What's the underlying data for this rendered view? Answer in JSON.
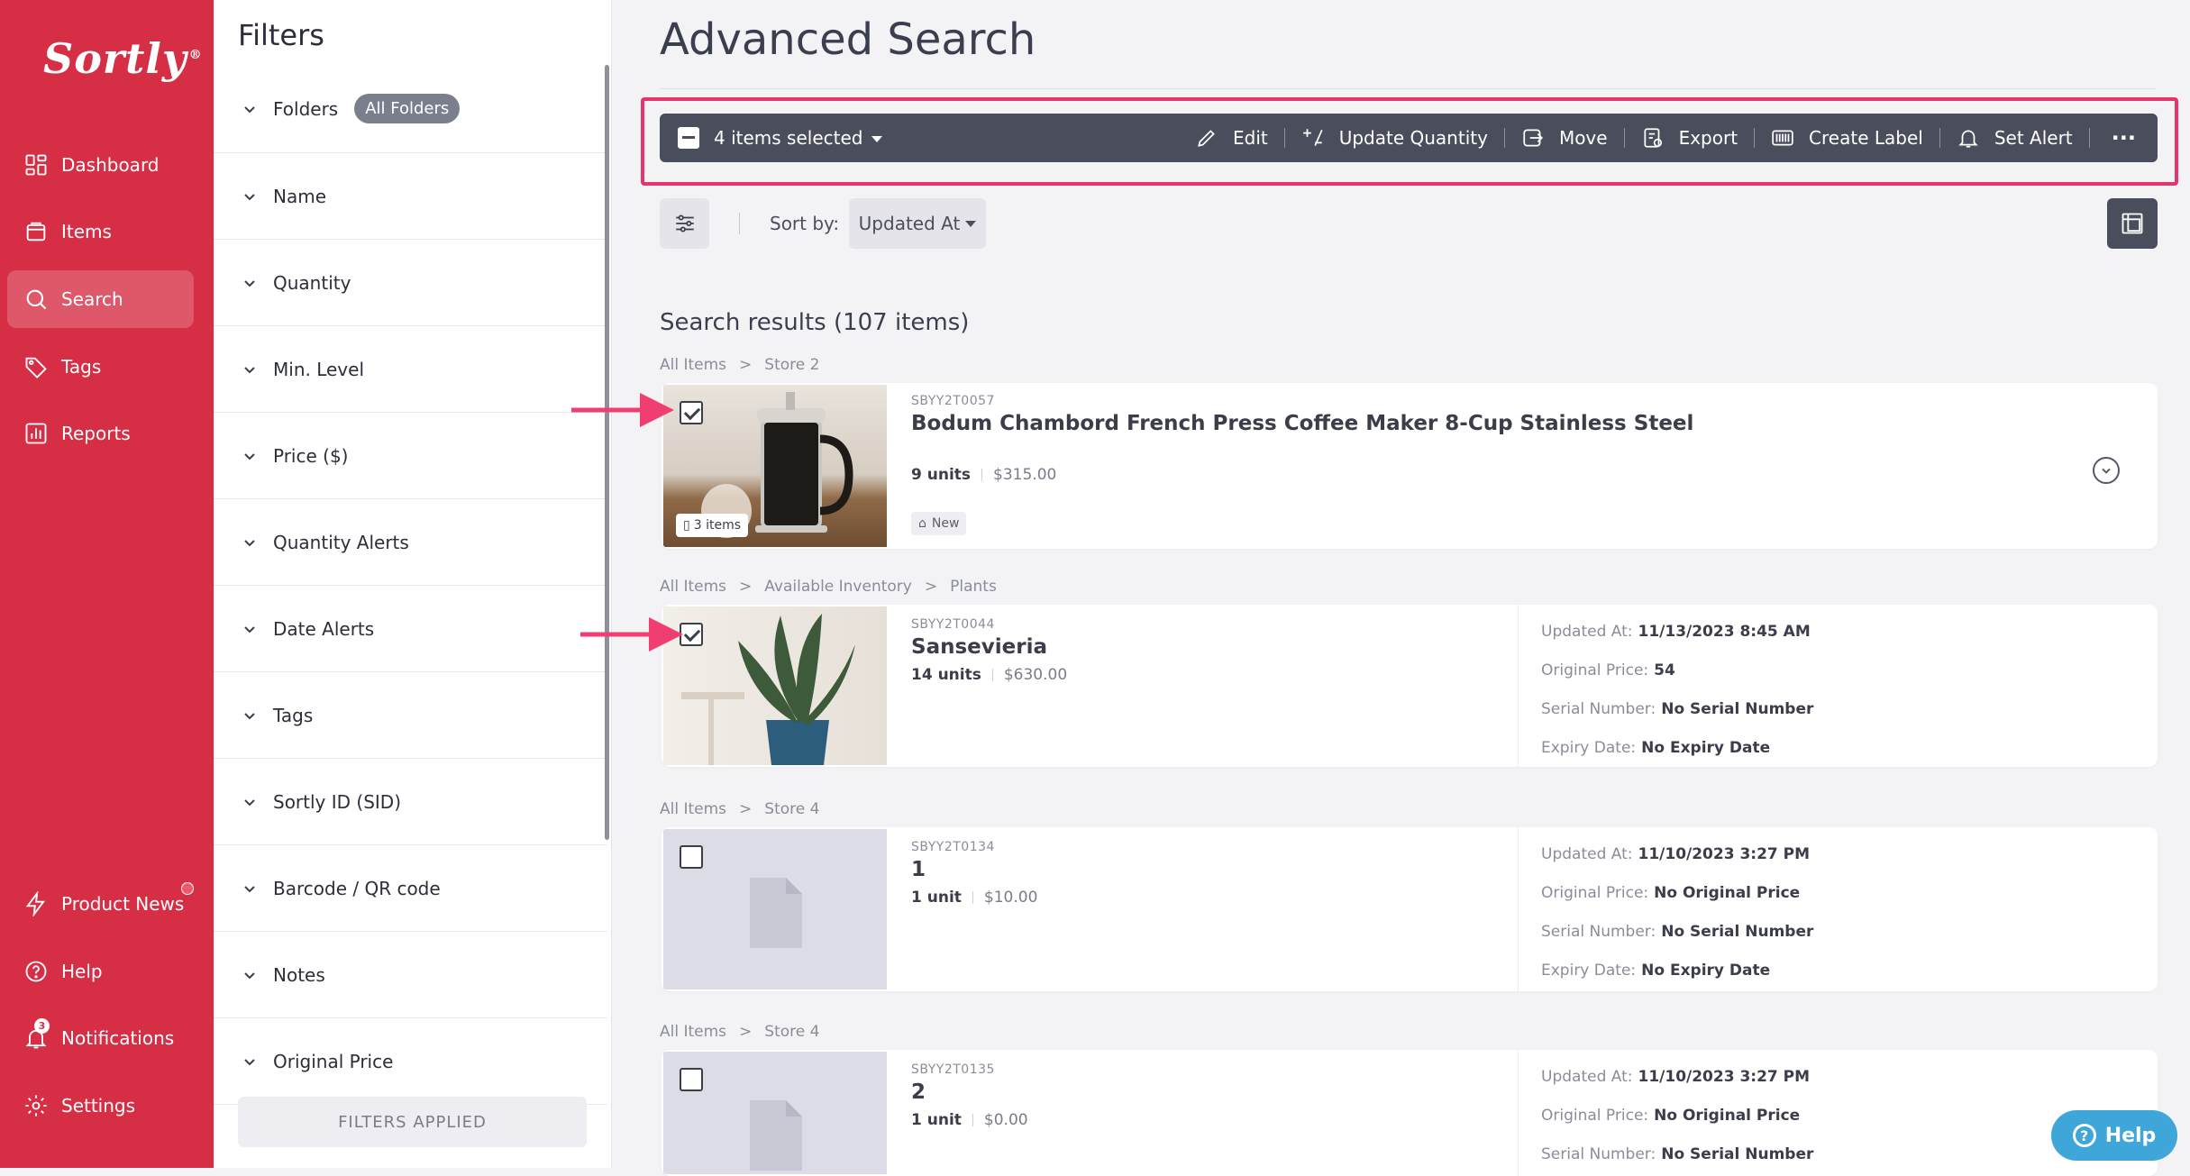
{
  "app": {
    "logo": "Sortly",
    "logo_mark": "®"
  },
  "sidebar": {
    "items": [
      {
        "label": "Dashboard",
        "icon": "dashboard-icon"
      },
      {
        "label": "Items",
        "icon": "items-icon"
      },
      {
        "label": "Search",
        "icon": "search-icon",
        "active": true
      },
      {
        "label": "Tags",
        "icon": "tag-icon"
      },
      {
        "label": "Reports",
        "icon": "reports-icon"
      }
    ],
    "bottom": [
      {
        "label": "Product News",
        "icon": "lightning-icon"
      },
      {
        "label": "Help",
        "icon": "help-icon"
      },
      {
        "label": "Notifications",
        "icon": "bell-icon",
        "badge": "3"
      },
      {
        "label": "Settings",
        "icon": "gear-icon"
      }
    ]
  },
  "filters": {
    "title": "Filters",
    "folders_label": "Folders",
    "folders_value": "All Folders",
    "rows": [
      "Name",
      "Quantity",
      "Min. Level",
      "Price ($)",
      "Quantity Alerts",
      "Date Alerts",
      "Tags",
      "Sortly ID (SID)",
      "Barcode / QR code",
      "Notes",
      "Original Price"
    ],
    "applied_button": "FILTERS APPLIED"
  },
  "main": {
    "title": "Advanced Search",
    "toolbar": {
      "selection": "4 items selected",
      "actions": {
        "edit": "Edit",
        "update_quantity": "Update Quantity",
        "move": "Move",
        "export": "Export",
        "create_label": "Create Label",
        "set_alert": "Set Alert"
      },
      "more": "···"
    },
    "sort": {
      "label": "Sort by:",
      "value": "Updated At"
    },
    "results_title": "Search results (107 items)"
  },
  "results": [
    {
      "breadcrumb": [
        "All Items",
        "Store 2"
      ],
      "sid": "SBYY2T0057",
      "name": "Bodum Chambord French Press Coffee Maker 8-Cup Stainless Steel",
      "units": "9 units",
      "price": "$315.00",
      "tag": "New",
      "items_badge": "3 items",
      "checked": true
    },
    {
      "breadcrumb": [
        "All Items",
        "Available Inventory",
        "Plants"
      ],
      "sid": "SBYY2T0044",
      "name": "Sansevieria",
      "units": "14 units",
      "price": "$630.00",
      "checked": true,
      "details": {
        "updated_at_label": "Updated At:",
        "updated_at": "11/13/2023 8:45 AM",
        "original_price_label": "Original Price:",
        "original_price": "54",
        "serial_label": "Serial Number:",
        "serial": "No Serial Number",
        "expiry_label": "Expiry Date:",
        "expiry": "No Expiry Date"
      }
    },
    {
      "breadcrumb": [
        "All Items",
        "Store 4"
      ],
      "sid": "SBYY2T0134",
      "name": "1",
      "units": "1 unit",
      "price": "$10.00",
      "checked": false,
      "details": {
        "updated_at_label": "Updated At:",
        "updated_at": "11/10/2023 3:27 PM",
        "original_price_label": "Original Price:",
        "original_price": "No Original Price",
        "serial_label": "Serial Number:",
        "serial": "No Serial Number",
        "expiry_label": "Expiry Date:",
        "expiry": "No Expiry Date"
      }
    },
    {
      "breadcrumb": [
        "All Items",
        "Store 4"
      ],
      "sid": "SBYY2T0135",
      "name": "2",
      "units": "1 unit",
      "price": "$0.00",
      "checked": false,
      "details": {
        "updated_at_label": "Updated At:",
        "updated_at": "11/10/2023 3:27 PM",
        "original_price_label": "Original Price:",
        "original_price": "No Original Price",
        "serial_label": "Serial Number:",
        "serial": "No Serial Number"
      }
    }
  ],
  "help_button": "Help",
  "colors": {
    "brand": "#d62f45",
    "toolbar": "#4a4d5c",
    "highlight": "#e6356d",
    "help": "#3ea6d8"
  }
}
